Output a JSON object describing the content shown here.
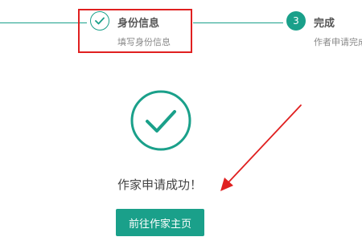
{
  "stepper": {
    "step2": {
      "title": "身份信息",
      "subtitle": "填写身份信息"
    },
    "step3": {
      "number": "3",
      "title": "完成",
      "subtitle": "作者申请完成"
    }
  },
  "success": {
    "icon": "check-circle-icon",
    "message": "作家申请成功！"
  },
  "actions": {
    "go_home_label": "前往作家主页"
  },
  "colors": {
    "accent": "#1aa08a",
    "highlight": "#e02020"
  }
}
